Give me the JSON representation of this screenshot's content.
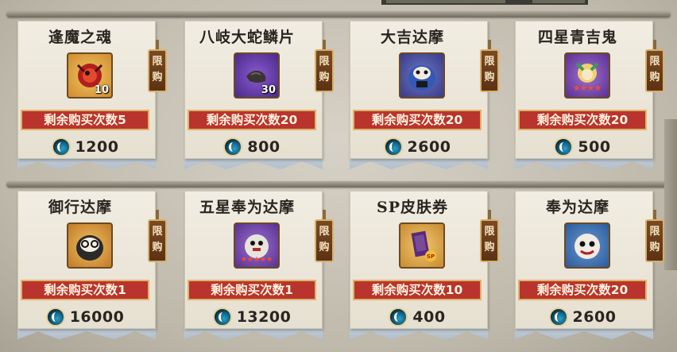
{
  "colors": {
    "remain_bg": "#b8342c",
    "remain_border": "#e0b36a",
    "tag_bg": "#6a3c1a"
  },
  "limit_tag": [
    "限",
    "购"
  ],
  "items": [
    {
      "name": "逢魔之魂",
      "qty": "10",
      "remain": "剩余购买次数5",
      "price": "1200",
      "icon": "feng-mo-soul-icon"
    },
    {
      "name": "八岐大蛇鳞片",
      "qty": "30",
      "remain": "剩余购买次数20",
      "price": "800",
      "icon": "orochi-scale-icon"
    },
    {
      "name": "大吉达摩",
      "qty": "",
      "remain": "剩余购买次数20",
      "price": "2600",
      "icon": "daikichi-daruma-icon"
    },
    {
      "name": "四星青吉鬼",
      "qty": "",
      "remain": "剩余购买次数20",
      "price": "500",
      "icon": "four-star-aokichi-icon"
    },
    {
      "name": "御行达摩",
      "qty": "",
      "remain": "剩余购买次数1",
      "price": "16000",
      "icon": "gyo-daruma-icon"
    },
    {
      "name": "五星奉为达摩",
      "qty": "",
      "remain": "剩余购买次数1",
      "price": "13200",
      "icon": "five-star-hotei-daruma-icon"
    },
    {
      "name": "SP皮肤券",
      "qty": "",
      "remain": "剩余购买次数10",
      "price": "400",
      "icon": "sp-skin-ticket-icon"
    },
    {
      "name": "奉为达摩",
      "qty": "",
      "remain": "剩余购买次数20",
      "price": "2600",
      "icon": "hotei-daruma-icon"
    }
  ]
}
